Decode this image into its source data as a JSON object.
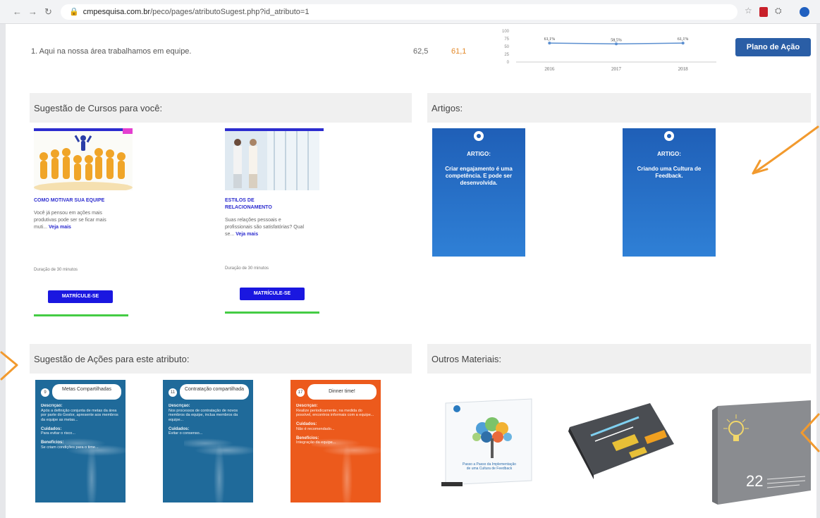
{
  "browser": {
    "url_host": "cmpesquisa.com.br",
    "url_path": "/peco/pages/atributoSugest.php?id_atributo=1"
  },
  "attribute": {
    "text": "1. Aqui na nossa área trabalhamos em equipe.",
    "score_a": "62,5",
    "score_b": "61,1",
    "plano_label": "Plano de Ação"
  },
  "chart_data": {
    "type": "line",
    "categories": [
      "2016",
      "2017",
      "2018"
    ],
    "values": [
      61.1,
      58.5,
      61.1
    ],
    "data_labels": [
      "61,1%",
      "58,5%",
      "61,1%"
    ],
    "y_ticks": [
      "100",
      "75",
      "50",
      "25",
      "0"
    ],
    "ylim": [
      0,
      100
    ],
    "color": "#5b8fd0"
  },
  "courses": {
    "heading": "Sugestão de Cursos para você:",
    "items": [
      {
        "title": "COMO MOTIVAR SUA EQUIPE",
        "desc": "Você já pensou em ações mais produtivas pode ser se ficar mais muti...",
        "more": "Veja mais",
        "duration": "Duração de 30 minutos",
        "button": "MATRÍCULE-SE"
      },
      {
        "title": "ESTILOS DE RELACIONAMENTO",
        "desc": "Suas relações pessoais e profissionais são satisfatórias? Qual se...",
        "more": "Veja mais",
        "duration": "Duração de 30 minutos",
        "button": "MATRÍCULE-SE"
      }
    ]
  },
  "artigos": {
    "heading": "Artigos:",
    "items": [
      {
        "label": "ARTIGO:",
        "text": "Criar engajamento é uma competência. E pode ser desenvolvida."
      },
      {
        "label": "ARTIGO:",
        "text": "Criando uma Cultura de Feedback."
      }
    ]
  },
  "acoes": {
    "heading": "Sugestão de Ações para este atributo:",
    "items": [
      {
        "num": "9",
        "title": "Metas Compartilhadas",
        "color": "#1f6a9a",
        "body_head": "Descrição:",
        "body": "Após a definição conjunta de metas da área por parte do Gestor, apresente aos membros da equipe as metas...",
        "care_head": "Cuidados:",
        "care": "Para evitar o risco...",
        "benefit_head": "Benefícios:",
        "benefit": "Se criam condições para o time..."
      },
      {
        "num": "11",
        "title": "Contratação compartilhada",
        "color": "#1f6a9a",
        "body_head": "Descrição:",
        "body": "Nos processos de contratação de novos membros da equipe, inclua membros da equipe...",
        "care_head": "Cuidados:",
        "care": "Evitar o consenso...",
        "benefit_head": "",
        "benefit": ""
      },
      {
        "num": "17",
        "title": "Dinner time!",
        "color": "#ec5a1c",
        "body_head": "Descrição:",
        "body": "Realize periodicamente, na medida do possível, encontros informais com a equipe...",
        "care_head": "Cuidados:",
        "care": "Não é recomendado...",
        "benefit_head": "Benefícios:",
        "benefit": "Integração da equipe..."
      }
    ]
  },
  "materiais": {
    "heading": "Outros Materiais:",
    "items": [
      {
        "name": "ebook-cultura-feedback",
        "caption": "Passo a Passo da Implementação de uma Cultura de Feedback"
      },
      {
        "name": "ebook-engajamento",
        "caption": ""
      },
      {
        "name": "ebook-22-ideias",
        "caption": "22"
      }
    ]
  },
  "colors": {
    "accent_orange": "#f29a2e",
    "primary_blue": "#2a5ea6",
    "course_blue": "#2c2ccf"
  }
}
